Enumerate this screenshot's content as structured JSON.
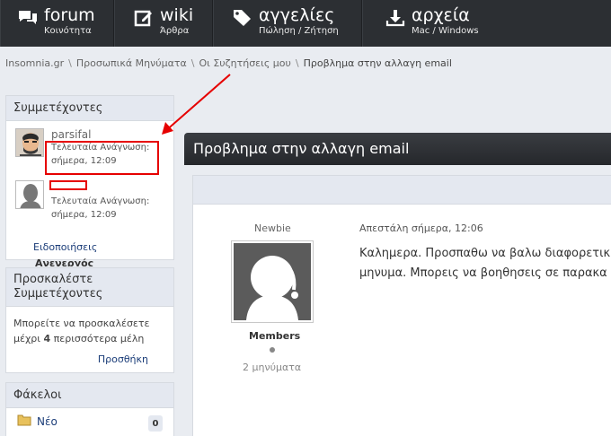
{
  "nav": [
    {
      "title": "forum",
      "subtitle": "Κοινότητα",
      "icon": "chat-bubbles-icon"
    },
    {
      "title": "wiki",
      "subtitle": "Άρθρα",
      "icon": "edit-icon"
    },
    {
      "title": "αγγελίες",
      "subtitle": "Πώληση / Ζήτηση",
      "icon": "tags-icon"
    },
    {
      "title": "αρχεία",
      "subtitle": "Mac / Windows",
      "icon": "download-icon"
    }
  ],
  "breadcrumb": [
    "Insomnia.gr",
    "Προσωπικά Μηνύματα",
    "Οι Συζητήσεις μου",
    "Προβλημα στην αλλαγη email"
  ],
  "breadcrumb_sep": "\\",
  "participants_panel": {
    "title": "Συμμετέχοντες",
    "participants": [
      {
        "name": "parsifal",
        "last_read_label": "Τελευταία Ανάγνωση:",
        "last_read_time": "σήμερα, 12:09"
      },
      {
        "name": "",
        "last_read_label": "Τελευταία Ανάγνωση:",
        "last_read_time": "σήμερα, 12:09"
      }
    ],
    "notifications_link": "Ειδοποιήσεις",
    "cut_text": "Ανενεργός"
  },
  "invite_panel": {
    "title": "Προσκαλέστε Συμμετέχοντες",
    "text_before": "Μπορείτε να προσκαλέσετε μέχρι ",
    "count": "4",
    "text_after": " περισσότερα μέλη",
    "add_link": "Προσθήκη"
  },
  "folders_panel": {
    "title": "Φάκελοι",
    "folder": "Νέο",
    "count": "0"
  },
  "conversation": {
    "title": "Προβλημα στην αλλαγη email",
    "rank": "Newbie",
    "group": "Members",
    "messages": "2 μηνύματα",
    "sent": "Απεστάλη σήμερα, 12:06",
    "body_line1": "Καλημερα. Προσπαθω να βαλω διαφορετικ",
    "body_line2": "μηνυμα. Μπορεις να βοηθησεις σε παρακα"
  },
  "colors": {
    "nav_bg": "#2c2f33",
    "accent_red": "#e60000",
    "link": "#1a3c78",
    "panel_head": "#e4e8f0"
  }
}
